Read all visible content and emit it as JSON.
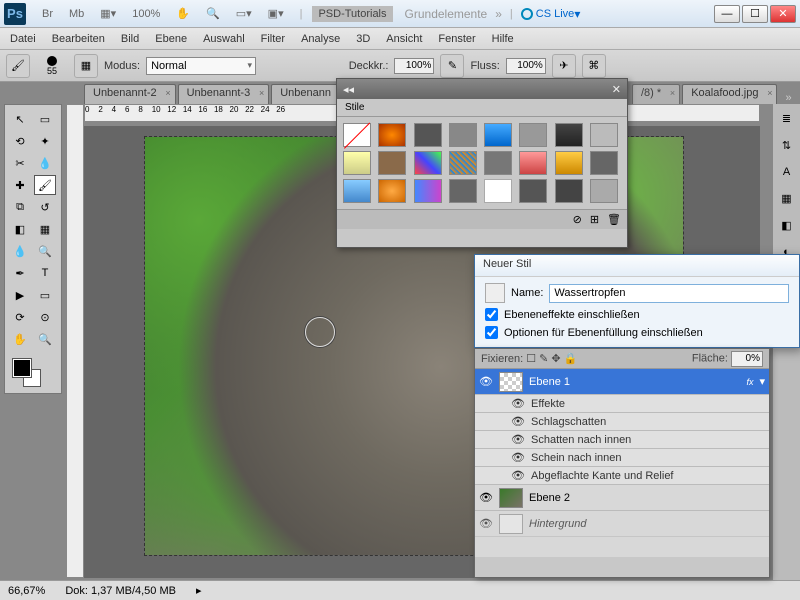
{
  "titlebar": {
    "zoom": "100%",
    "psd_tutorials": "PSD-Tutorials",
    "grundelemente": "Grundelemente",
    "cs_live": "CS Live"
  },
  "menu": [
    "Datei",
    "Bearbeiten",
    "Bild",
    "Ebene",
    "Auswahl",
    "Filter",
    "Analyse",
    "3D",
    "Ansicht",
    "Fenster",
    "Hilfe"
  ],
  "options": {
    "brush_size": "55",
    "mode_label": "Modus:",
    "mode_value": "Normal",
    "opacity_label": "Deckkr.:",
    "opacity_value": "100%",
    "flow_label": "Fluss:",
    "flow_value": "100%"
  },
  "tabs": [
    {
      "label": "Unbenannt-2",
      "close": "×"
    },
    {
      "label": "Unbenannt-3",
      "close": "×"
    },
    {
      "label": "Unbenann",
      "close": "×"
    },
    {
      "label": "/8) *",
      "close": "×"
    },
    {
      "label": "Koalafood.jpg",
      "close": "×"
    }
  ],
  "styles_panel": {
    "title": "Stile",
    "footer_delete": "⌫"
  },
  "dialog": {
    "title": "Neuer Stil",
    "name_label": "Name:",
    "name_value": "Wassertropfen",
    "cb1": "Ebeneneffekte einschließen",
    "cb2": "Optionen für Ebenenfüllung einschließen"
  },
  "layers": {
    "lock_label": "Fixieren:",
    "fill_label": "Fläche:",
    "fill_value": "0%",
    "items": [
      {
        "name": "Ebene 1",
        "fx": "fx"
      },
      {
        "name": "Effekte"
      },
      {
        "name": "Schlagschatten"
      },
      {
        "name": "Schatten nach innen"
      },
      {
        "name": "Schein nach innen"
      },
      {
        "name": "Abgeflachte Kante und Relief"
      }
    ],
    "layer2": "Ebene 2",
    "bg": "Hintergrund"
  },
  "status": {
    "zoom": "66,67%",
    "doc": "Dok: 1,37 MB/4,50 MB"
  }
}
